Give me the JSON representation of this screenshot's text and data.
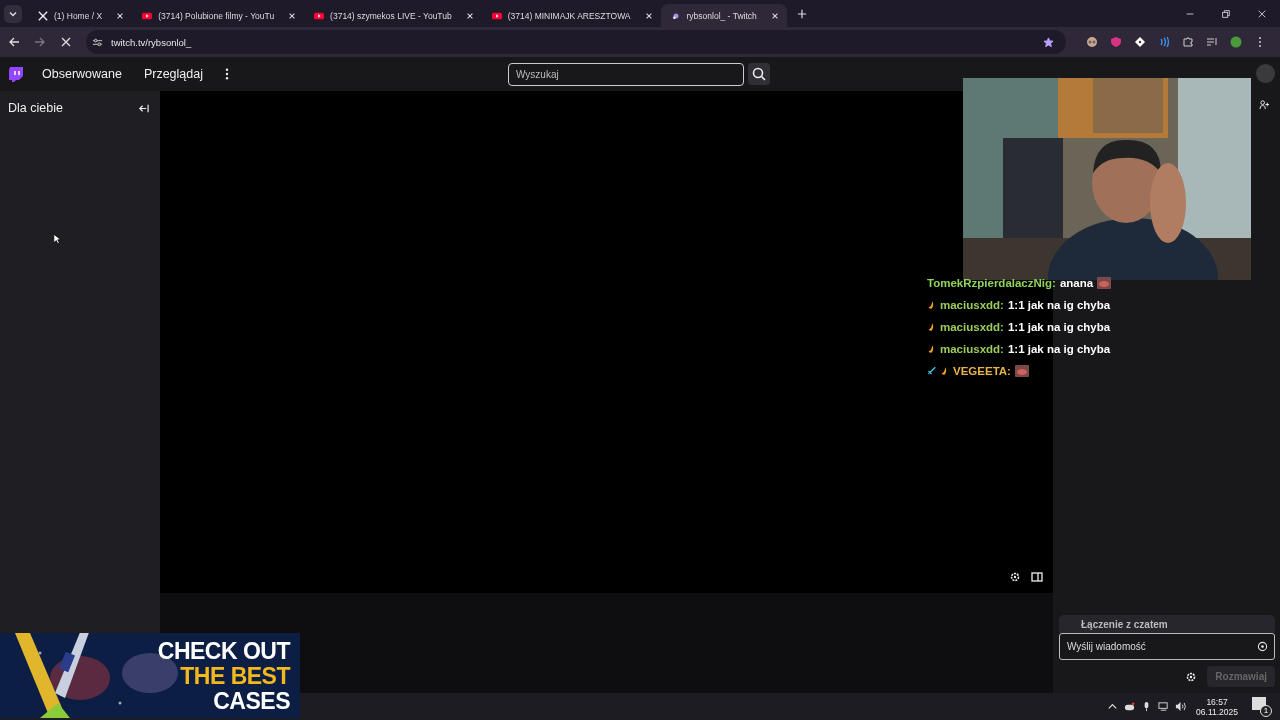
{
  "browser": {
    "tabs": [
      {
        "kind": "x",
        "title": "(1) Home / X",
        "selected": false
      },
      {
        "kind": "youtube",
        "title": "(3714) Polubione filmy - YouTu",
        "selected": false
      },
      {
        "kind": "youtube",
        "title": "(3714) szymekos LIVE - YouTub",
        "selected": false
      },
      {
        "kind": "youtube",
        "title": "(3714) MINIMAJK ARESZTOWA",
        "selected": false
      },
      {
        "kind": "twitch",
        "title": "rybsonlol_ - Twitch",
        "selected": true
      }
    ],
    "address": "twitch.tv/rybsonlol_",
    "bookmarked": true
  },
  "nav": {
    "links": [
      "Obserwowane",
      "Przeglądaj"
    ],
    "search": {
      "placeholder": "Wyszukaj"
    }
  },
  "sidebar": {
    "title": "Dla ciebie"
  },
  "chat_overlay": [
    {
      "user": "TomekRzpierdalaczNig:",
      "color": "#8fd45a",
      "text": "anana",
      "emote": true
    },
    {
      "badges": [
        {
          "kind": "moon"
        }
      ],
      "user": "maciusxdd:",
      "color": "#9acd5a",
      "text": "1:1 jak na ig chyba",
      "emote": false
    },
    {
      "badges": [
        {
          "kind": "moon"
        }
      ],
      "user": "maciusxdd:",
      "color": "#9acd5a",
      "text": "1:1 jak na ig chyba",
      "emote": false
    },
    {
      "badges": [
        {
          "kind": "moon"
        }
      ],
      "user": "maciusxdd:",
      "color": "#9acd5a",
      "text": "1:1 jak na ig chyba",
      "emote": false
    },
    {
      "badges": [
        {
          "kind": "sword"
        },
        {
          "kind": "moon"
        }
      ],
      "user": "VEGEETA:",
      "color": "#e8b24a",
      "emote": true
    }
  ],
  "chat": {
    "status": "Łączenie z czatem",
    "placeholder": "Wyślij wiadomość",
    "send_button": "Rozmawiaj"
  },
  "ad": {
    "lines": [
      {
        "text": "CHECK OUT",
        "color": "#ffffff"
      },
      {
        "text": "THE BEST",
        "color": "#f5b81c"
      },
      {
        "text": "CASES",
        "color": "#ffffff"
      }
    ]
  },
  "taskbar": {
    "time": "16:57",
    "date": "06.11.2025",
    "notifications": "1"
  }
}
